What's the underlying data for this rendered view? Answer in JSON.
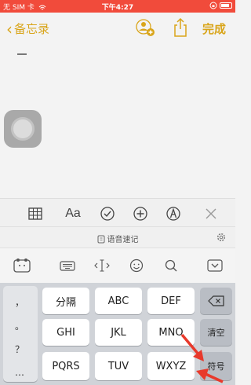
{
  "status_bar": {
    "carrier": "无 SIM 卡",
    "time": "下午4:27"
  },
  "nav": {
    "back_label": "备忘录",
    "done_label": "完成"
  },
  "format_toolbar": {
    "text_style_label": "Aa"
  },
  "voice_bar": {
    "label": "语音速记"
  },
  "keyboard": {
    "left_column": [
      "，",
      "。",
      "？",
      "…"
    ],
    "rows": [
      [
        "分隔",
        "ABC",
        "DEF"
      ],
      [
        "GHI",
        "JKL",
        "MNO"
      ],
      [
        "PQRS",
        "TUV",
        "WXYZ"
      ]
    ],
    "right_keys": {
      "clear": "清空",
      "symbol": "符号"
    }
  },
  "colors": {
    "status_bar": "#f14b3b",
    "accent": "#d9a51a",
    "arrow": "#e8392b"
  }
}
